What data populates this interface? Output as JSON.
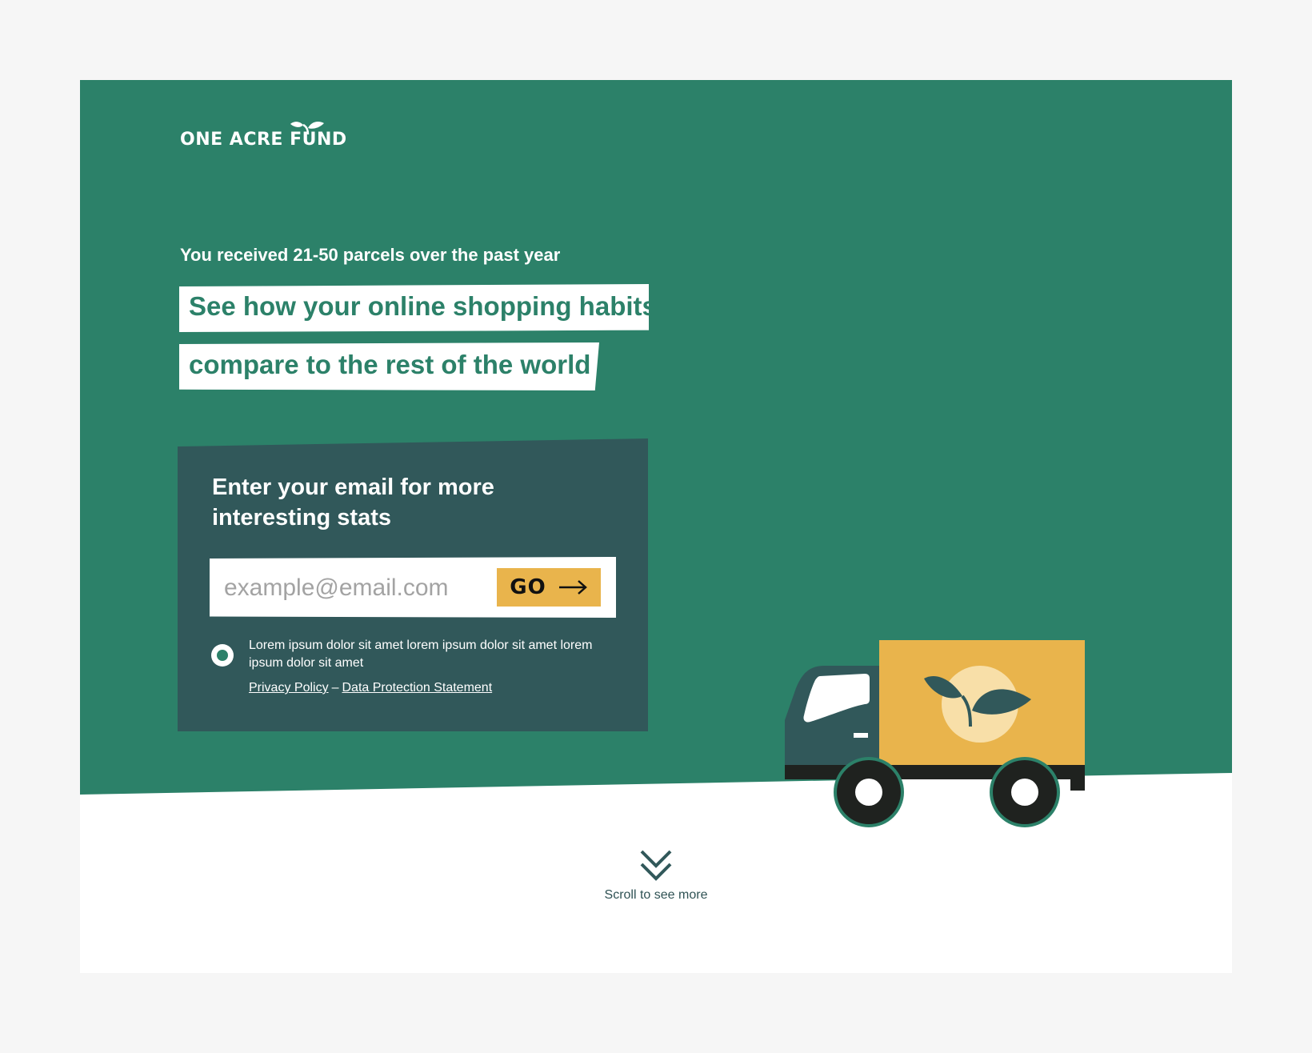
{
  "brand": {
    "name": "ONE ACRE FUND"
  },
  "hero": {
    "subheading": "You received 21-50 parcels over the past year",
    "headline_line1": "See how your online shopping habits",
    "headline_line2": "compare to the rest of the world"
  },
  "form": {
    "title": "Enter your email for more interesting stats",
    "email_placeholder": "example@email.com",
    "email_value": "",
    "submit_label": "GO",
    "consent_text": "Lorem ipsum dolor sit amet lorem ipsum dolor sit amet lorem ipsum dolor sit amet",
    "privacy_link": "Privacy Policy",
    "separator": "–",
    "data_protection_link": "Data Protection Statement"
  },
  "footer": {
    "scroll_label": "Scroll to see more"
  },
  "icons": {
    "logo_leaf": "leaf-icon",
    "submit_arrow": "arrow-right-icon",
    "scroll": "chevron-double-down-icon",
    "illustration": "delivery-truck-illustration"
  },
  "colors": {
    "page_background": "#f6f6f6",
    "hero_green": "#2c8169",
    "panel_teal": "#31585a",
    "accent_yellow": "#e9b44c",
    "white": "#ffffff"
  }
}
